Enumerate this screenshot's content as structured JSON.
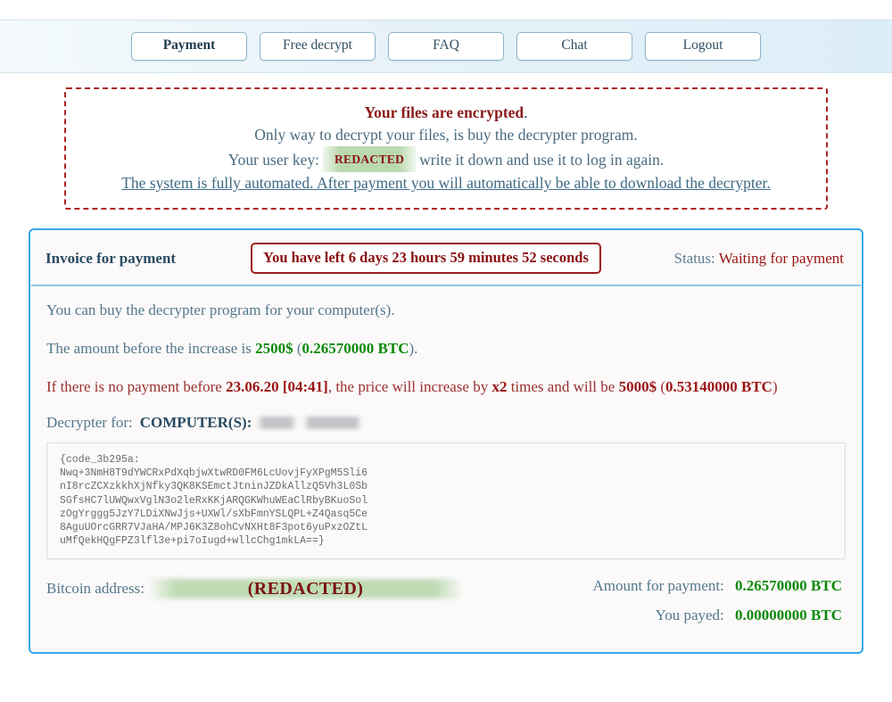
{
  "nav": {
    "items": [
      {
        "label": "Payment",
        "active": true
      },
      {
        "label": "Free decrypt",
        "active": false
      },
      {
        "label": "FAQ",
        "active": false
      },
      {
        "label": "Chat",
        "active": false
      },
      {
        "label": "Logout",
        "active": false
      }
    ]
  },
  "warning": {
    "line1_bold": "Your files are encrypted",
    "line1_tail": ".",
    "line2": "Only way to decrypt your files, is buy the decrypter program.",
    "line3_pre": "Your user key:",
    "line3_key": "REDACTED",
    "line3_post": "write it down and use it to log in again.",
    "line4": "The system is fully automated. After payment you will automatically be able to download the decrypter."
  },
  "invoice": {
    "title": "Invoice for payment",
    "timer": "You have left 6 days 23 hours 59 minutes 52 seconds",
    "status_label": "Status:",
    "status_value": "Waiting for payment",
    "intro": "You can buy the decrypter program for your computer(s).",
    "amount_line": {
      "pre": "The amount before the increase is",
      "usd": "2500$",
      "mid_open": "(",
      "btc": "0.26570000 BTC",
      "mid_close": ")."
    },
    "increase_line": {
      "pre": "If there is no payment before",
      "deadline": "23.06.20 [04:41]",
      "mid": ", the price will increase by",
      "multiplier": "x2",
      "mid2": "times and will be",
      "usd": "5000$",
      "btc_open": "(",
      "btc": "0.53140000 BTC",
      "btc_close": ")"
    },
    "decrypter_for_label": "Decrypter for:",
    "computers_label": "COMPUTER(S):",
    "computers_value_redacted": "",
    "code_block": "{code_3b295a:\nNwq+3NmH8T9dYWCRxPdXqbjwXtwRD0FM6LcUovjFyXPgM5Sli6\nnI8rcZCXzkkhXjNfky3QK8KSEmctJtninJZDkAllzQ5Vh3L0Sb\nSGfsHC7lUWQwxVglN3o2leRxKKjARQGKWhuWEaClRbyBKuoSol\nzOgYrggg5JzY7LDiXNwJjs+UXWl/sXbFmnYSLQPL+Z4Qasq5Ce\n8AguUOrcGRR7VJaHA/MPJ6K3Z8ohCvNXHt8F3pot6yuPxzOZtL\nuMfQekHQgFPZ3lfl3e+pi7oIugd+wllcChg1mkLA==}",
    "btc_address_label": "Bitcoin address:",
    "btc_address_value": "(REDACTED)",
    "amount_for_payment_label": "Amount for payment:",
    "amount_for_payment_value": "0.26570000 BTC",
    "you_payed_label": "You payed:",
    "you_payed_value": "0.00000000 BTC"
  },
  "colors": {
    "accent_blue": "#35a7ea",
    "warning_red": "#b02323",
    "money_green": "#0a8a0a",
    "text_blue_gray": "#53788d",
    "dark_red": "#9b1515"
  }
}
